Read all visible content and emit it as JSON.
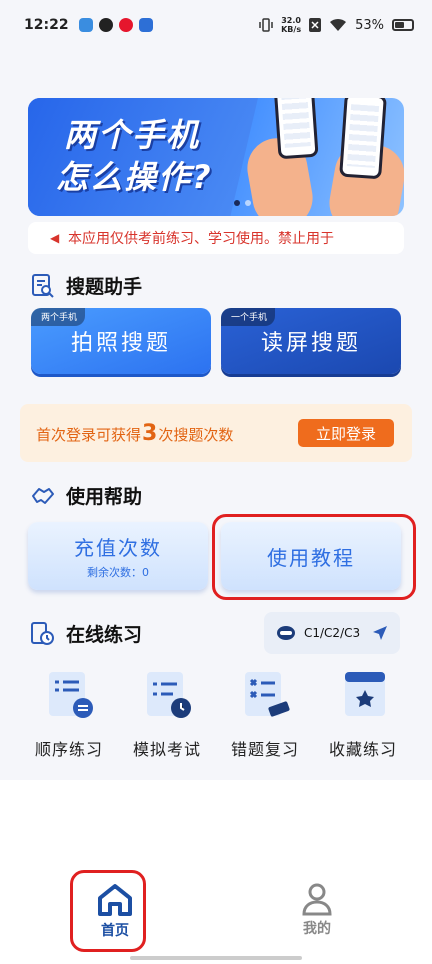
{
  "status_bar": {
    "time": "12:22",
    "net_speed_value": "32.0",
    "net_speed_unit": "KB/s",
    "battery": "53%"
  },
  "banner": {
    "line1": "两个手机",
    "line2": "怎么操作?"
  },
  "notice": {
    "text": "本应用仅供考前练习、学习使用。禁止用于"
  },
  "search_section": {
    "title": "搜题助手",
    "photo": {
      "tag": "两个手机",
      "label": "拍照搜题"
    },
    "read": {
      "tag": "一个手机",
      "label": "读屏搜题"
    }
  },
  "login_prompt": {
    "text_before": "首次登录可获得",
    "count": "3",
    "text_after": "次搜题次数",
    "button": "立即登录"
  },
  "help_section": {
    "title": "使用帮助",
    "recharge_label": "充值次数",
    "remaining_text": "剩余次数：0",
    "tutorial_label": "使用教程"
  },
  "practice_section": {
    "title": "在线练习",
    "license_types": "C1/C2/C3",
    "items": [
      {
        "label": "顺序练习"
      },
      {
        "label": "模拟考试"
      },
      {
        "label": "错题复习"
      },
      {
        "label": "收藏练习"
      }
    ]
  },
  "tabbar": {
    "home_label": "首页",
    "mine_label": "我的"
  },
  "colors": {
    "primary_blue": "#2c72f0",
    "dark_blue": "#1b48b0",
    "orange": "#ef6c1d",
    "warning_red": "#d8342c",
    "highlight_red": "#e02020"
  }
}
